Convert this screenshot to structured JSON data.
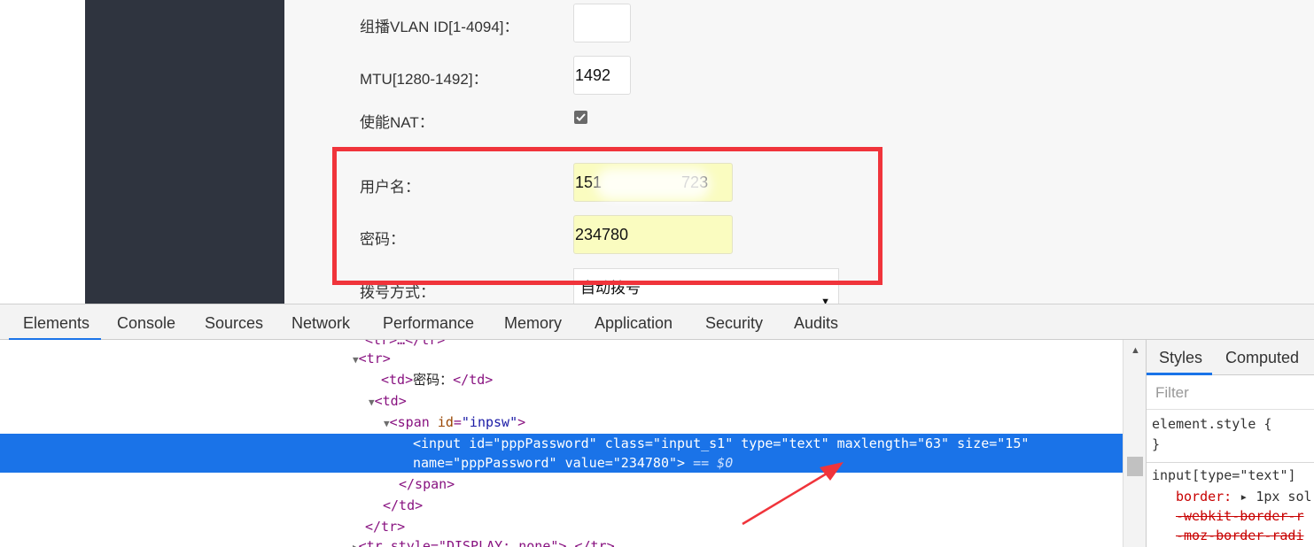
{
  "form": {
    "multicast_vlan_label": "组播VLAN ID[1-4094]：",
    "multicast_vlan_value": "",
    "mtu_label": "MTU[1280-1492]：",
    "mtu_value": "1492",
    "nat_label": "使能NAT：",
    "nat_checked": true,
    "username_label": "用户名：",
    "username_value_prefix": "151",
    "username_value_suffix": "723",
    "password_label": "密码：",
    "password_value": "234780",
    "dial_label": "拨号方式：",
    "dial_value": "自动拨号"
  },
  "colors": {
    "highlight_box": "#f0343b",
    "sidebar": "#2f343f",
    "selected_row": "#1a73e8",
    "autofill": "#fafcc0"
  },
  "devtools": {
    "tabs": [
      "Elements",
      "Console",
      "Sources",
      "Network",
      "Performance",
      "Memory",
      "Application",
      "Security",
      "Audits"
    ],
    "active_tab": "Elements",
    "code": {
      "l0": "<tr>…</tr>",
      "l1_tag": "<tr>",
      "l2_open": "<td>",
      "l2_text": "密码：",
      "l2_close": "</td>",
      "l3_tag": "<td>",
      "l4_open": "<span ",
      "l4_attr": "id",
      "l4_val": "\"inpsw\"",
      "l4_close": ">",
      "sel1_a": "<input ",
      "sel1_b": "id",
      "sel1_c": "=\"pppPassword\" ",
      "sel1_d": "class",
      "sel1_e": "=\"input_s1\" ",
      "sel1_f": "type",
      "sel1_g": "=\"text\" ",
      "sel1_h": "maxlength",
      "sel1_i": "=\"63\" ",
      "sel1_j": "size",
      "sel1_k": "=\"15\"",
      "sel2_a": "name",
      "sel2_b": "=\"pppPassword\" ",
      "sel2_c": "value",
      "sel2_d": "=\"234780\">",
      "sel2_e": " == $0",
      "l7": "</span>",
      "l8": "</td>",
      "l9": "</tr>",
      "l10": "<tr style=\"DISPLAY: none\">…</tr>"
    },
    "styles": {
      "tabs": [
        "Styles",
        "Computed"
      ],
      "filter_placeholder": "Filter",
      "rule1_selector": "element.style {",
      "rule1_close": "}",
      "rule2_selector": "input[type=\"text\"]",
      "rule2_prop1": "border:",
      "rule2_val1": "1px sol",
      "rule2_strike1": "-webkit-border-r",
      "rule2_strike2": "-moz-border-radi"
    },
    "icons": {
      "expand": "triangle-down-icon",
      "collapsed": "triangle-right-icon",
      "scroll_up": "triangle-up-icon"
    }
  }
}
